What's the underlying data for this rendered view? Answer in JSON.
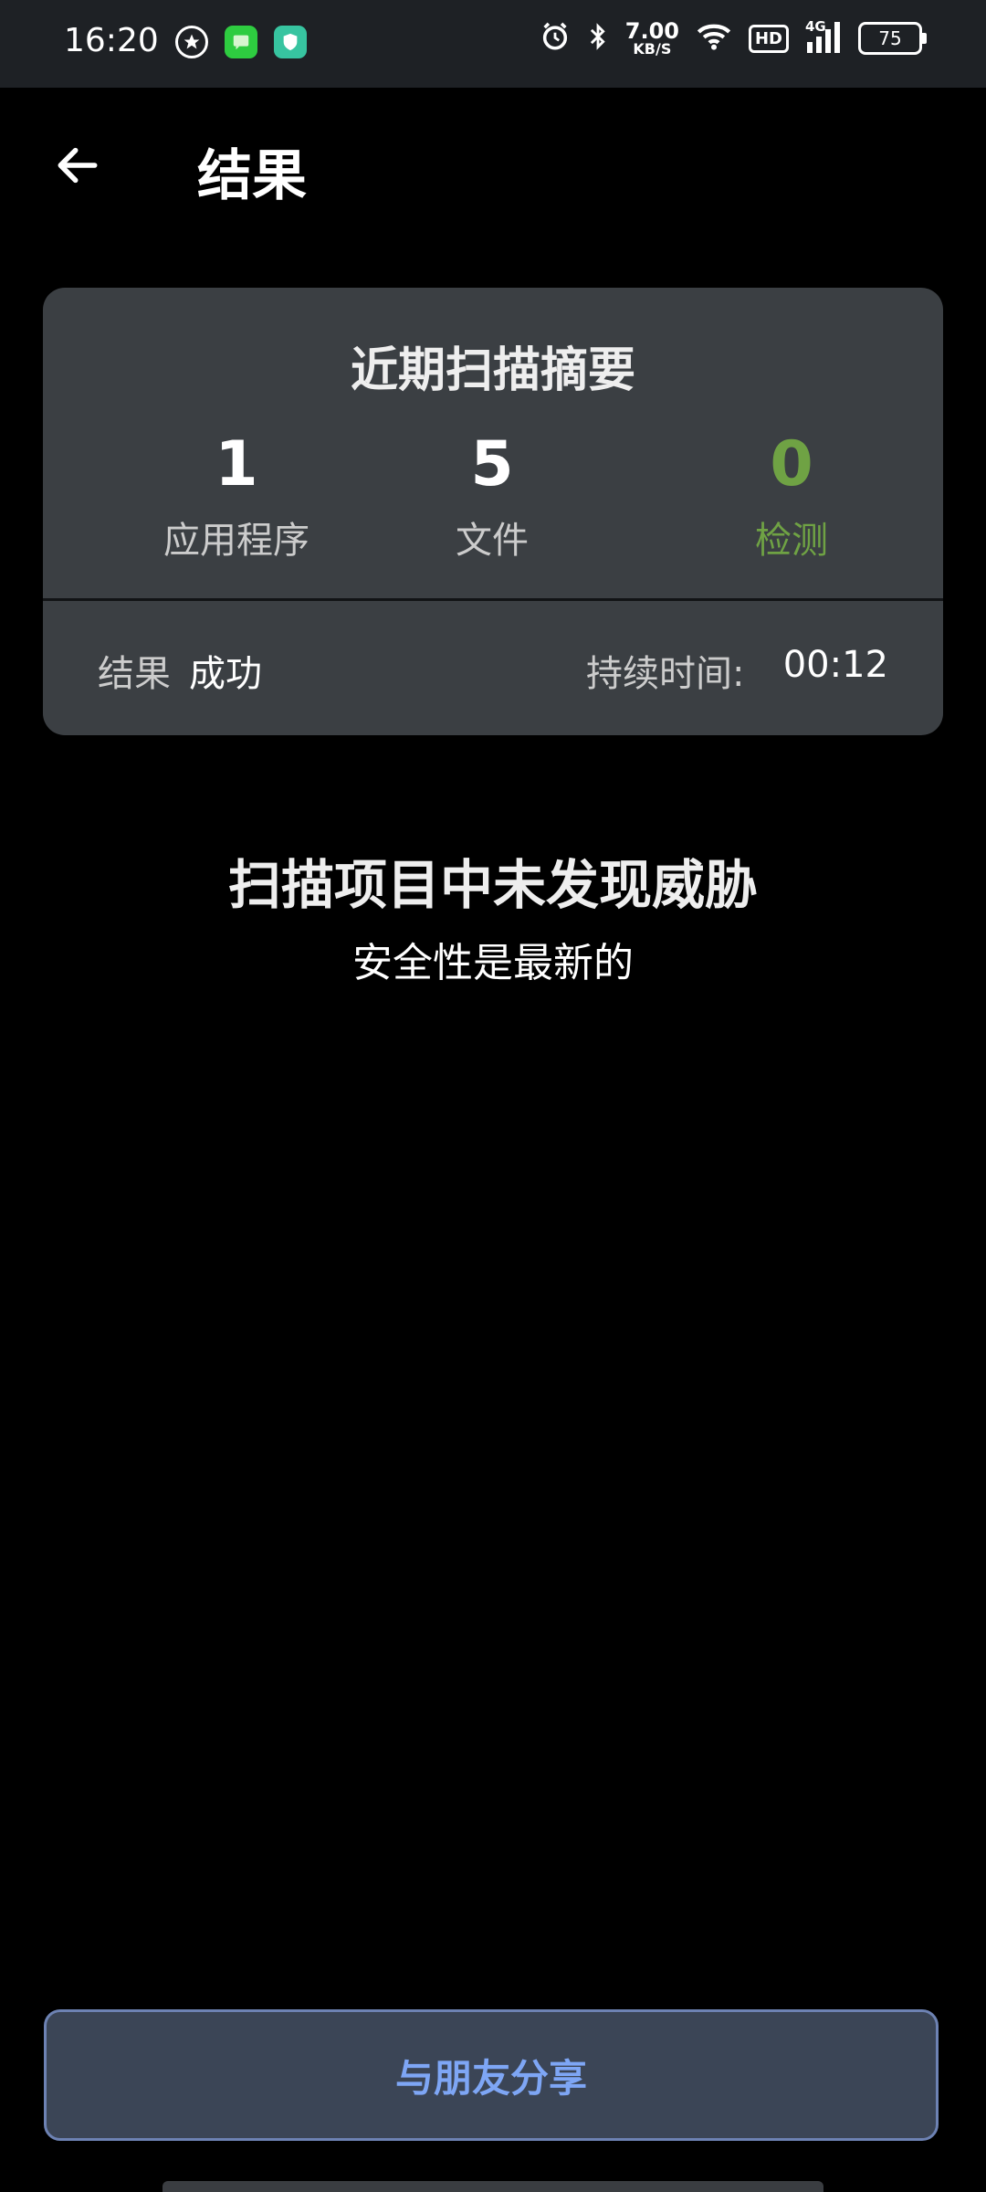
{
  "status_bar": {
    "time": "16:20",
    "speed_value": "7.00",
    "speed_unit": "KB/S",
    "hd": "HD",
    "network": "4G",
    "battery": "75"
  },
  "app_bar": {
    "title": "结果"
  },
  "summary": {
    "title": "近期扫描摘要",
    "stats": [
      {
        "value": "1",
        "label": "应用程序"
      },
      {
        "value": "5",
        "label": "文件"
      },
      {
        "value": "0",
        "label": "检测"
      }
    ],
    "result_label": "结果",
    "result_value": "成功",
    "duration_label": "持续时间:",
    "duration_value": "00:12"
  },
  "messages": {
    "main": "扫描项目中未发现威胁",
    "sub": "安全性是最新的"
  },
  "share_button": {
    "label": "与朋友分享"
  },
  "colors": {
    "accent_green": "#6fa244",
    "button_text": "#7ea6f5",
    "card_bg": "#3b3f43"
  }
}
